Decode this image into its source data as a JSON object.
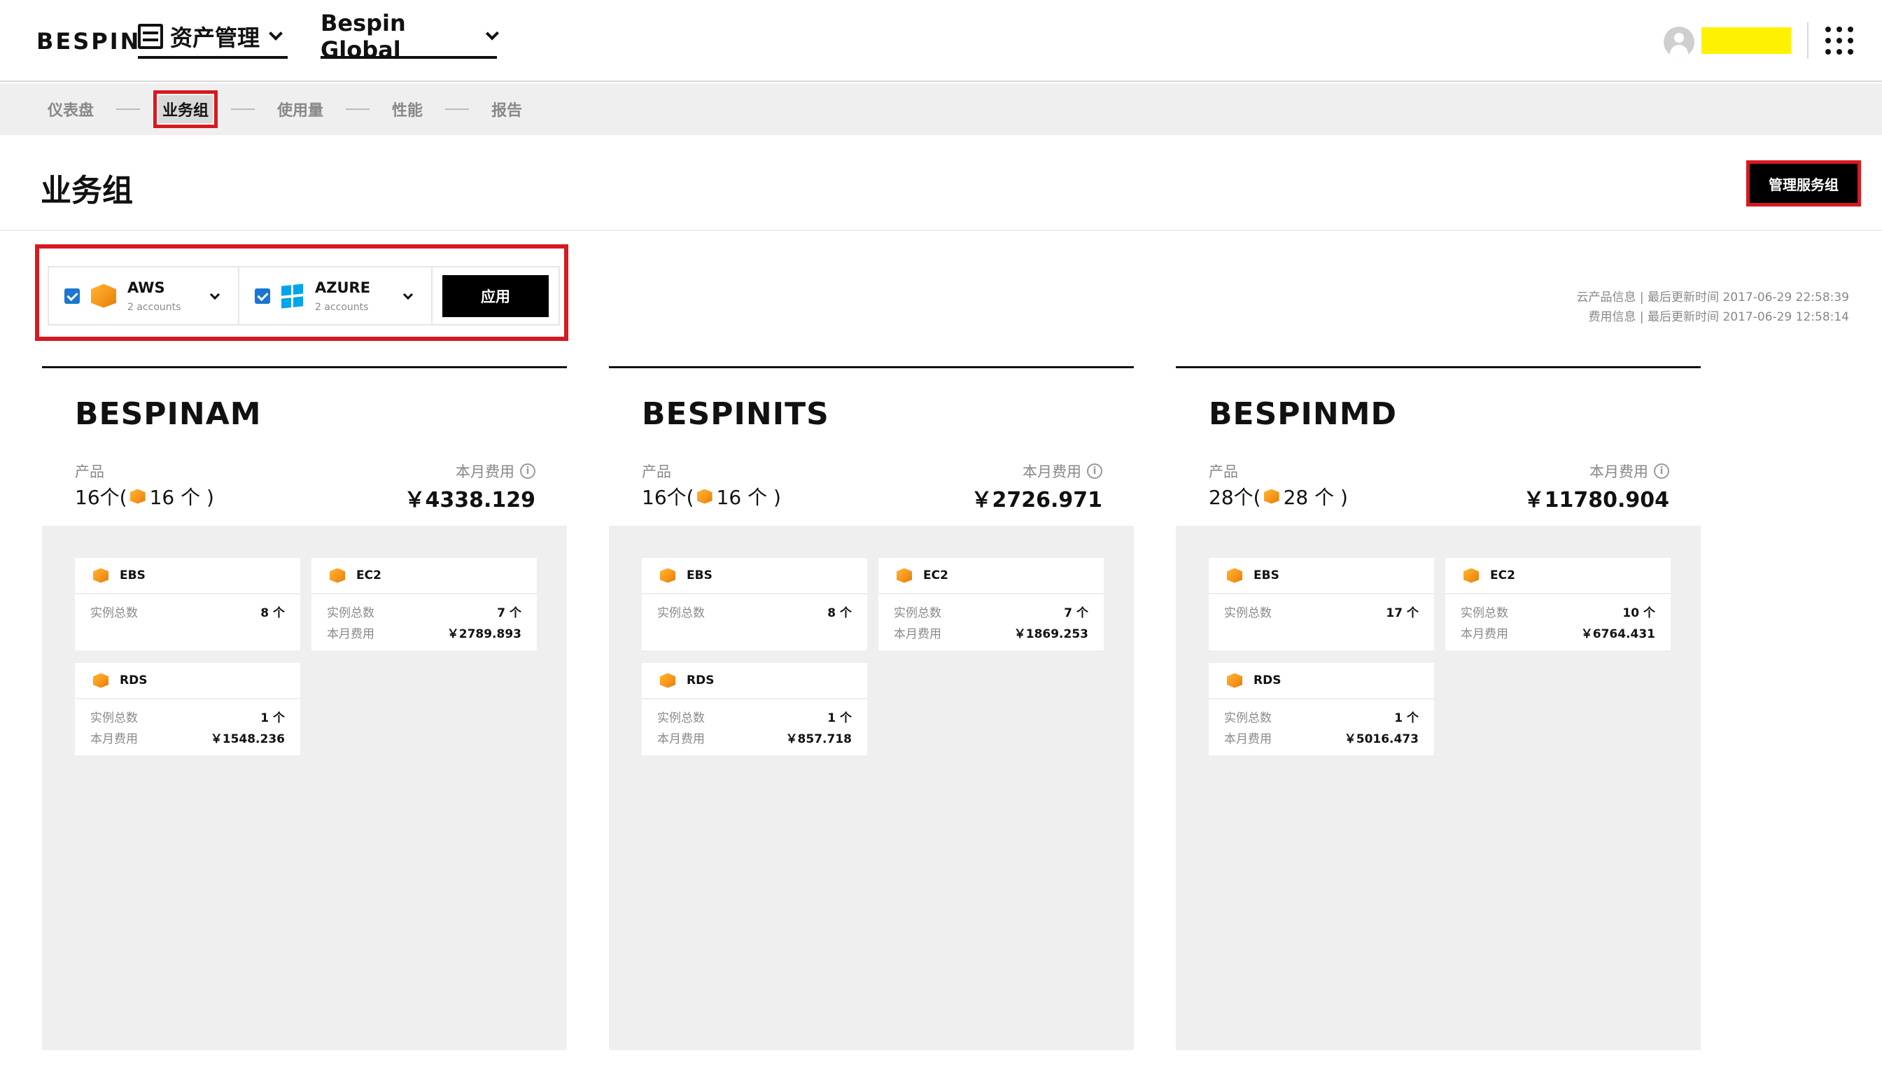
{
  "header": {
    "logo": "BESPIN",
    "asset_menu": "资产管理",
    "company_menu": "Bespin Global"
  },
  "subnav": {
    "items": [
      "仪表盘",
      "业务组",
      "使用量",
      "性能",
      "报告"
    ],
    "active_index": 1
  },
  "page": {
    "title": "业务组",
    "manage_button": "管理服务组"
  },
  "filter": {
    "providers": [
      {
        "name": "AWS",
        "accounts": "2 accounts",
        "checked": true
      },
      {
        "name": "AZURE",
        "accounts": "2 accounts",
        "checked": true
      }
    ],
    "apply_label": "应用"
  },
  "update_info": {
    "line1": "云产品信息 | 最后更新时间 2017-06-29 22:58:39",
    "line2": "费用信息 | 最后更新时间 2017-06-29 12:58:14"
  },
  "groups": [
    {
      "name": "BESPINAM",
      "product_label": "产品",
      "product_count": "16个(",
      "product_aws": "16 个 )",
      "cost_label": "本月费用",
      "cost": "￥4338.129",
      "services": [
        {
          "name": "EBS",
          "rows": [
            {
              "label": "实例总数",
              "value": "8 个"
            }
          ]
        },
        {
          "name": "EC2",
          "rows": [
            {
              "label": "实例总数",
              "value": "7 个"
            },
            {
              "label": "本月费用",
              "value": "￥2789.893"
            }
          ]
        },
        {
          "name": "RDS",
          "rows": [
            {
              "label": "实例总数",
              "value": "1 个"
            },
            {
              "label": "本月费用",
              "value": "￥1548.236"
            }
          ]
        }
      ]
    },
    {
      "name": "BESPINITS",
      "product_label": "产品",
      "product_count": "16个(",
      "product_aws": "16 个 )",
      "cost_label": "本月费用",
      "cost": "￥2726.971",
      "services": [
        {
          "name": "EBS",
          "rows": [
            {
              "label": "实例总数",
              "value": "8 个"
            }
          ]
        },
        {
          "name": "EC2",
          "rows": [
            {
              "label": "实例总数",
              "value": "7 个"
            },
            {
              "label": "本月费用",
              "value": "￥1869.253"
            }
          ]
        },
        {
          "name": "RDS",
          "rows": [
            {
              "label": "实例总数",
              "value": "1 个"
            },
            {
              "label": "本月费用",
              "value": "￥857.718"
            }
          ]
        }
      ]
    },
    {
      "name": "BESPINMD",
      "product_label": "产品",
      "product_count": "28个(",
      "product_aws": "28 个 )",
      "cost_label": "本月费用",
      "cost": "￥11780.904",
      "services": [
        {
          "name": "EBS",
          "rows": [
            {
              "label": "实例总数",
              "value": "17 个"
            }
          ]
        },
        {
          "name": "EC2",
          "rows": [
            {
              "label": "实例总数",
              "value": "10 个"
            },
            {
              "label": "本月费用",
              "value": "￥6764.431"
            }
          ]
        },
        {
          "name": "RDS",
          "rows": [
            {
              "label": "实例总数",
              "value": "1 个"
            },
            {
              "label": "本月费用",
              "value": "￥5016.473"
            }
          ]
        }
      ]
    }
  ],
  "colors": {
    "highlight_red": "#d71920",
    "aws_orange": "#f7961d",
    "azure_blue": "#00a4ef",
    "checkbox_blue": "#1976d2",
    "username_redaction": "#fff200"
  }
}
